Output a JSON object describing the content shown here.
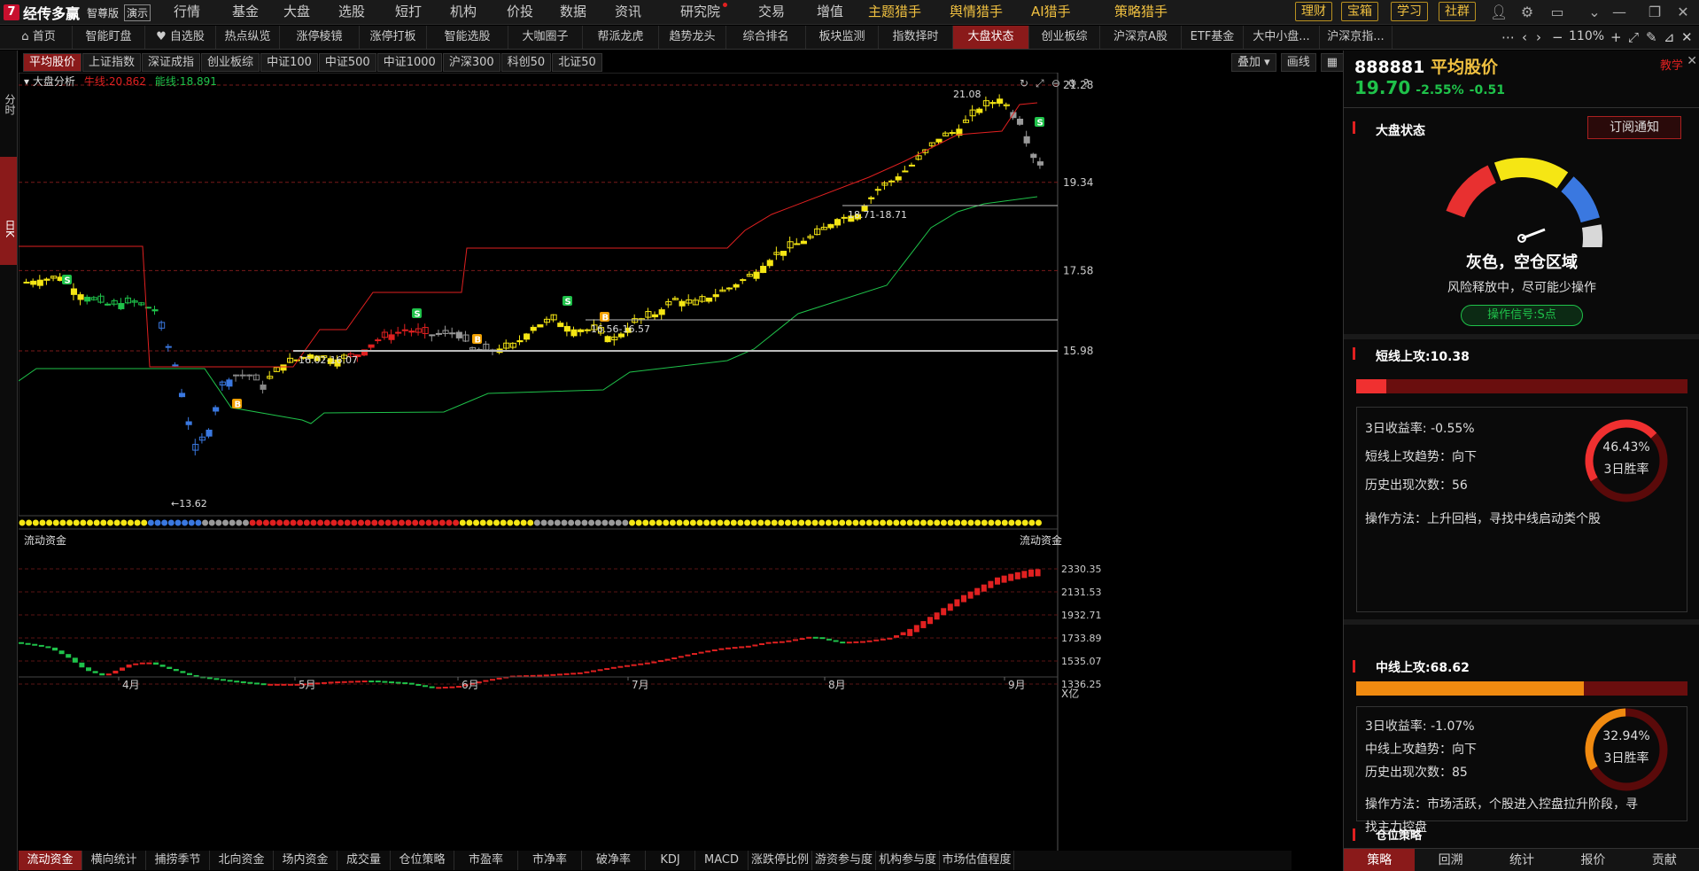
{
  "app": {
    "logo_char": "7",
    "name": "经传多赢",
    "edition": "智尊版",
    "demo": "演示"
  },
  "top_menu": [
    "行情",
    "基金",
    "大盘",
    "选股",
    "短打",
    "机构",
    "价投",
    "数据",
    "资讯",
    "研究院",
    "交易",
    "增值",
    "主题猎手",
    "舆情猎手",
    "AI猎手",
    "策略猎手"
  ],
  "top_buttons": [
    "理财",
    "宝箱",
    "学习",
    "社群"
  ],
  "nav": [
    "首页",
    "智能盯盘",
    "自选股",
    "热点纵览",
    "涨停棱镜",
    "涨停打板",
    "智能选股",
    "大咖圈子",
    "帮派龙虎",
    "趋势龙头",
    "综合排名",
    "板块监测",
    "指数择时",
    "大盘状态",
    "创业板综",
    "沪深京A股",
    "ETF基金",
    "大中小盘...",
    "沪深京指..."
  ],
  "nav_active": "大盘状态",
  "nav_zoom": "110%",
  "left_tabs": [
    "分时",
    "日K"
  ],
  "index_tabs": [
    "平均股价",
    "上证指数",
    "深证成指",
    "创业板综",
    "中证100",
    "中证500",
    "中证1000",
    "沪深300",
    "科创50",
    "北证50"
  ],
  "chart_toolbar": {
    "overlay": "叠加",
    "draw": "画线"
  },
  "main_chart": {
    "indicator": "大盘分析",
    "bull_label": "牛线:20.862",
    "energy_label": "能线:18.891",
    "y_labels": [
      "21.28",
      "19.34",
      "17.58",
      "15.98"
    ],
    "high_label": "21.08",
    "low_label": "13.62",
    "zones": [
      "16.02-16.07",
      "16.56-16.57",
      "18.71-18.71"
    ]
  },
  "sub_chart": {
    "title": "流动资金",
    "right_title": "流动资金",
    "y_labels": [
      "2330.35",
      "2131.53",
      "1932.71",
      "1733.89",
      "1535.07",
      "1336.25"
    ],
    "unit": "X亿"
  },
  "x_labels": [
    "4月",
    "5月",
    "6月",
    "7月",
    "8月",
    "9月"
  ],
  "bottom_tabs": [
    "流动资金",
    "横向统计",
    "捕捞季节",
    "北向资金",
    "场内资金",
    "成交量",
    "仓位策略",
    "市盈率",
    "市净率",
    "破净率",
    "KDJ",
    "MACD",
    "涨跌停比例",
    "游资参与度",
    "机构参与度",
    "市场估值程度"
  ],
  "panel": {
    "code": "888881",
    "name": "平均股价",
    "price": "19.70",
    "pct": "-2.55%",
    "chg": "-0.51",
    "teach": "教学",
    "state_title": "大盘状态",
    "subscribe": "订阅通知",
    "gauge": {
      "status": "灰色，空仓区域",
      "desc": "风险释放中，尽可能少操作",
      "signal": "操作信号:S点",
      "colors": [
        "#e83030",
        "#f5e614",
        "#3a78e0",
        "#d8d8d8"
      ]
    },
    "short": {
      "title": "短线上攻:10.38",
      "level": 0.0907,
      "color": "#f03030",
      "ret": "3日收益率:  -0.55%",
      "trend": "短线上攻趋势：向下",
      "count": "历史出现次数：56",
      "method": "操作方法：上升回档，寻找中线启动类个股",
      "win": "46.43%",
      "win_label": "3日胜率",
      "win_frac": 0.4643
    },
    "mid": {
      "title": "中线上攻:68.62",
      "level": 0.6862,
      "color": "#f08a10",
      "ret": "3日收益率:  -1.07%",
      "trend": "中线上攻趋势：向下",
      "count": "历史出现次数：85",
      "method1": "操作方法：市场活跃，个股进入控盘拉升阶段，寻",
      "method2": "找主力控盘",
      "win": "32.94%",
      "win_label": "3日胜率",
      "win_frac": 0.3294
    },
    "pos_title": "仓位策略",
    "tabs": [
      "策略",
      "回溯",
      "统计",
      "报价",
      "贡献"
    ]
  }
}
